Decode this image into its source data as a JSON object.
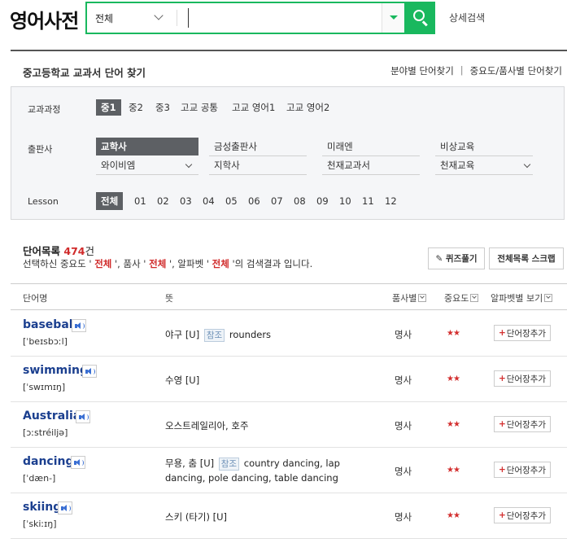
{
  "header": {
    "logo": "영어사전",
    "scope": "전체",
    "query": "",
    "advanced": "상세검색"
  },
  "section": {
    "title": "중고등학교 교과서 단어 찾기",
    "link1": "분야별 단어찾기",
    "sep": "|",
    "link2": "중요도/품사별 단어찾기"
  },
  "filters": {
    "curriculum_label": "교과과정",
    "curriculum": [
      "중1",
      "중2",
      "중3",
      "고교 공통",
      "고교 영어1",
      "고교 영어2"
    ],
    "publisher_label": "출판사",
    "publishers": [
      "교학사",
      "금성출판사",
      "미래엔",
      "비상교육",
      "와이비엠",
      "지학사",
      "천재교과서",
      "천재교육"
    ],
    "lesson_label": "Lesson",
    "lessons": [
      "전체",
      "01",
      "02",
      "03",
      "04",
      "05",
      "06",
      "07",
      "08",
      "09",
      "10",
      "11",
      "12"
    ]
  },
  "list": {
    "title": "단어목록",
    "count": "474",
    "unit": "건",
    "desc_pre": "선택하신 중요도 ' ",
    "desc_v1": "전체",
    "desc_mid1": " ', 품사 ' ",
    "desc_v2": "전체",
    "desc_mid2": " ', 알파벳 ' ",
    "desc_v3": "전체",
    "desc_post": " '의 검색결과 입니다.",
    "quiz_btn": "✎ 퀴즈풀기",
    "scrap_btn": "전체목록 스크랩"
  },
  "table": {
    "headers": [
      "단어명",
      "뜻",
      "품사별",
      "중요도",
      "알파벳별 보기"
    ],
    "add_label": "단어장추가",
    "ref_label": "참조",
    "rows": [
      {
        "word": "baseball",
        "pron": "[ˈbeɪsbɔːl]",
        "m1": "야구 [U]",
        "has_ref": true,
        "m2": "rounders",
        "pos": "명사",
        "stars": "★★"
      },
      {
        "word": "swimming",
        "pron": "[ˈswɪmɪŋ]",
        "m1": "수영 [U]",
        "has_ref": false,
        "m2": "",
        "pos": "명사",
        "stars": "★★"
      },
      {
        "word": "Australia",
        "pron": "[ɔːstréiljə]",
        "m1": "오스트레일리아, 호주",
        "has_ref": false,
        "m2": "",
        "pos": "명사",
        "stars": "★★"
      },
      {
        "word": "dancing",
        "pron": "[ˈdæn-]",
        "m1": "무용, 춤 [U]",
        "has_ref": true,
        "m2": "country dancing, lap dancing, pole dancing, table dancing",
        "pos": "명사",
        "stars": "★★"
      },
      {
        "word": "skiing",
        "pron": "[ˈskiːɪŋ]",
        "m1": "스키 (타기) [U]",
        "has_ref": false,
        "m2": "",
        "pos": "명사",
        "stars": "★★"
      }
    ]
  },
  "colors": {
    "accent": "#19b85e",
    "highlight": "#d02a2a",
    "word": "#1b3f8f"
  }
}
